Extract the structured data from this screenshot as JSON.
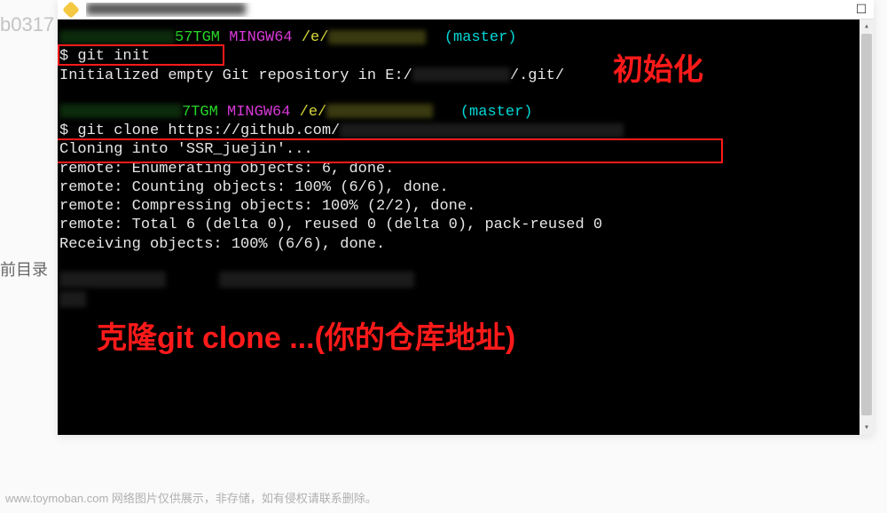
{
  "background": {
    "left_fragment": "b0317",
    "mid_fragment": "前目录",
    "right_fragment": ""
  },
  "window": {
    "title_blurred": true
  },
  "terminal": {
    "prompt1_suffix": "57TGM",
    "mingw": "MINGW64",
    "path": "/e/",
    "branch": "(master)",
    "cmd1_symbol": "$",
    "cmd1": " git init",
    "out1": "Initialized empty Git repository in E:/",
    "out1_suffix": "/.git/",
    "prompt2_suffix": "7TGM",
    "cmd2_symbol": "$",
    "cmd2": " git clone https://github.com/",
    "out2": "Cloning into 'SSR_juejin'...",
    "out3": "remote: Enumerating objects: 6, done.",
    "out4": "remote: Counting objects: 100% (6/6), done.",
    "out5": "remote: Compressing objects: 100% (2/2), done.",
    "out6": "remote: Total 6 (delta 0), reused 0 (delta 0), pack-reused 0",
    "out7": "Receiving objects: 100% (6/6), done."
  },
  "annotations": {
    "init_label": "初始化",
    "clone_label": "克隆git clone ...(你的仓库地址)"
  },
  "footer": "www.toymoban.com 网络图片仅供展示，非存储，如有侵权请联系删除。"
}
